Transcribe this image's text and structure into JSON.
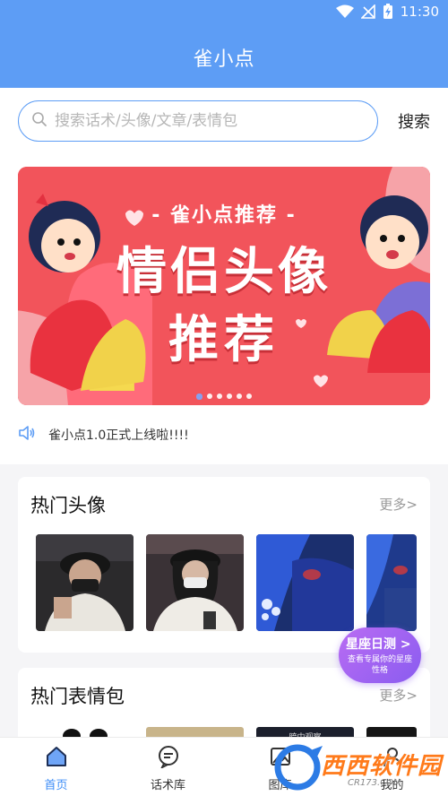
{
  "status_bar": {
    "time": "11:30"
  },
  "app_bar": {
    "title": "雀小点"
  },
  "search": {
    "placeholder": "搜索话术/头像/文章/表情包",
    "button_label": "搜索"
  },
  "banner": {
    "tag": "- 雀小点推荐 -",
    "line1": "情侣头像",
    "line2": "推荐",
    "dot_count": 6,
    "active_dot": 1
  },
  "notice": {
    "text": "雀小点1.0正式上线啦!!!!"
  },
  "hot_avatars": {
    "title": "热门头像",
    "more_label": "更多>",
    "thumbs": [
      "avatar-man-cap-mask",
      "avatar-woman-cap-mask",
      "avatar-blue-hair-neck",
      "avatar-blue-hair-partial"
    ]
  },
  "fab": {
    "title": "星座日测 >",
    "subtitle": "查看专属你的星座性格"
  },
  "hot_emoji": {
    "title": "热门表情包",
    "more_label": "更多>",
    "thumb_labels": [
      "",
      "",
      "暗中观察",
      ""
    ]
  },
  "tabs": [
    {
      "label": "首页",
      "icon": "home-icon",
      "active": true
    },
    {
      "label": "话术库",
      "icon": "chat-icon",
      "active": false
    },
    {
      "label": "图库",
      "icon": "gallery-icon",
      "active": false
    },
    {
      "label": "我的",
      "icon": "user-icon",
      "active": false
    }
  ],
  "watermark": {
    "text": "西西软件园",
    "url": "CR173.COM"
  },
  "colors": {
    "primary": "#5d9df5",
    "banner_red": "#f2545b",
    "fab_purple": "#9b63f2",
    "tab_active": "#3e8ef7"
  }
}
